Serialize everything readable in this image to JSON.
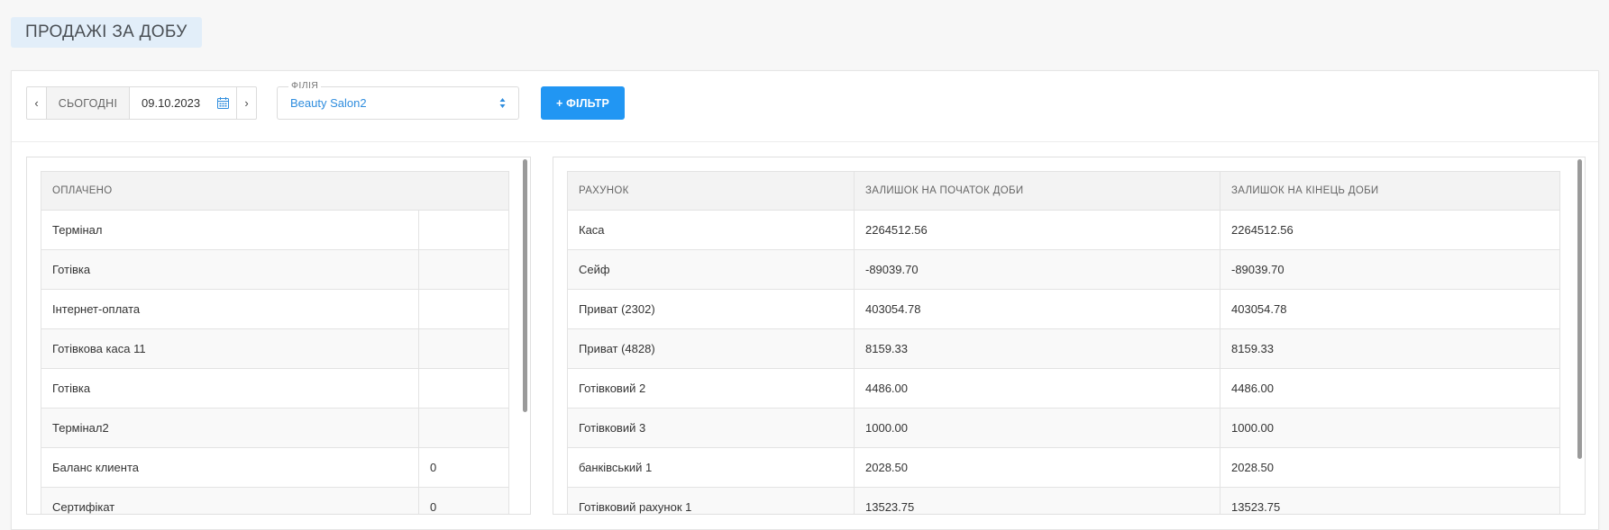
{
  "page": {
    "title": "ПРОДАЖІ ЗА ДОБУ"
  },
  "toolbar": {
    "prev": "‹",
    "next": "›",
    "today_label": "СЬОГОДНІ",
    "date_value": "09.10.2023",
    "branch_label": "ФІЛІЯ",
    "branch_value": "Beauty Salon2",
    "filter_label": "+ ФІЛЬТР"
  },
  "paid_table": {
    "header": "ОПЛАЧЕНО",
    "rows": [
      {
        "name": "Термінал",
        "value": ""
      },
      {
        "name": "Готівка",
        "value": ""
      },
      {
        "name": "Інтернет-оплата",
        "value": ""
      },
      {
        "name": "Готівкова каса 11",
        "value": ""
      },
      {
        "name": "Готівка",
        "value": ""
      },
      {
        "name": "Термінал2",
        "value": ""
      },
      {
        "name": "Баланс клиента",
        "value": "0"
      },
      {
        "name": "Сертифікат",
        "value": "0"
      }
    ]
  },
  "accounts_table": {
    "headers": [
      "РАХУНОК",
      "ЗАЛИШОК НА ПОЧАТОК ДОБИ",
      "ЗАЛИШОК НА КІНЕЦЬ ДОБИ"
    ],
    "rows": [
      {
        "account": "Каса",
        "start": "2264512.56",
        "end": "2264512.56"
      },
      {
        "account": "Сейф",
        "start": "-89039.70",
        "end": "-89039.70"
      },
      {
        "account": "Приват (2302)",
        "start": "403054.78",
        "end": "403054.78"
      },
      {
        "account": "Приват (4828)",
        "start": "8159.33",
        "end": "8159.33"
      },
      {
        "account": "Готівковий 2",
        "start": "4486.00",
        "end": "4486.00"
      },
      {
        "account": "Готівковий 3",
        "start": "1000.00",
        "end": "1000.00"
      },
      {
        "account": "банківський 1",
        "start": "2028.50",
        "end": "2028.50"
      },
      {
        "account": "Готівковий рахунок 1",
        "start": "13523.75",
        "end": "13523.75"
      }
    ]
  },
  "colors": {
    "accent": "#2196f3",
    "title_bg": "#e2eef9",
    "link": "#2f8dde"
  },
  "icons": {
    "date": "calendar-icon",
    "select": "sort-arrows-icon"
  }
}
